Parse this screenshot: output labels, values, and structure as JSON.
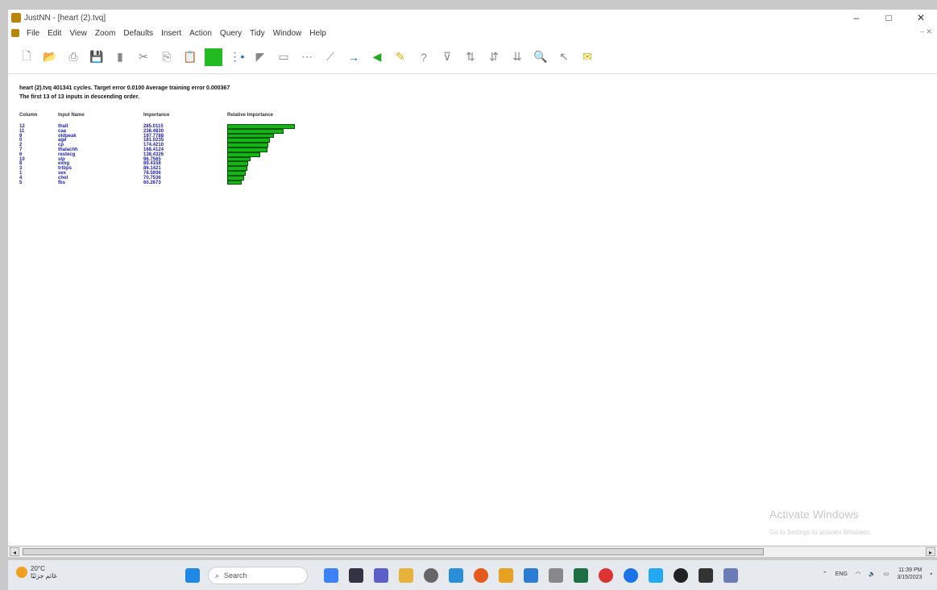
{
  "window": {
    "title": "JustNN - [heart (2).tvq]",
    "controls": [
      "–",
      "□",
      "✕"
    ]
  },
  "menu": [
    "File",
    "Edit",
    "View",
    "Zoom",
    "Defaults",
    "Insert",
    "Action",
    "Query",
    "Tidy",
    "Window",
    "Help"
  ],
  "menu_mdi": "– ✕",
  "toolbar_icons": [
    "new-file-icon",
    "open-file-icon",
    "print-icon",
    "save-icon",
    "column-icon",
    "cut-icon",
    "copy-icon",
    "paste-icon",
    "grid-icon",
    "network-icon",
    "learn-icon",
    "chart-icon",
    "link-icon",
    "graph-icon",
    "forward-icon",
    "flag-icon",
    "pen-icon",
    "query-icon",
    "filter-icon",
    "sort-icon",
    "sort2-icon",
    "zoom-icon",
    "wand-icon",
    "mail-icon"
  ],
  "report": {
    "line1": "heart (2).tvq   401341 cycles.  Target error 0.0100  Average training error 0.000367",
    "line2": "The first 13 of 13 inputs in descending order.",
    "headers": [
      "Column",
      "Input Name",
      "Importance",
      "Relative Importance"
    ],
    "rows": [
      {
        "column": "12",
        "name": "thall",
        "importance": "285.0115"
      },
      {
        "column": "11",
        "name": "caa",
        "importance": "238.4830"
      },
      {
        "column": "9",
        "name": "oldpeak",
        "importance": "197.7788"
      },
      {
        "column": "0",
        "name": "age",
        "importance": "181.0235"
      },
      {
        "column": "2",
        "name": "cp",
        "importance": "174.4210"
      },
      {
        "column": "7",
        "name": "thalachh",
        "importance": "168.4124"
      },
      {
        "column": "6",
        "name": "restecg",
        "importance": "138.4326"
      },
      {
        "column": "10",
        "name": "slp",
        "importance": "96.7565"
      },
      {
        "column": "8",
        "name": "exng",
        "importance": "89.4158"
      },
      {
        "column": "3",
        "name": "trtbps",
        "importance": "86.1421"
      },
      {
        "column": "1",
        "name": "sex",
        "importance": "78.5936"
      },
      {
        "column": "4",
        "name": "chol",
        "importance": "70.7536"
      },
      {
        "column": "5",
        "name": "fbs",
        "importance": "60.2673"
      }
    ]
  },
  "watermark": {
    "title": "Activate Windows",
    "subtitle": "Go to Settings to activate Windows."
  },
  "taskbar": {
    "weather_temp": "20°C",
    "weather_desc": "غائم جزئيًا",
    "search_placeholder": "Search",
    "lang": "ENG",
    "time": "11:39 PM",
    "date": "3/15/2023"
  }
}
